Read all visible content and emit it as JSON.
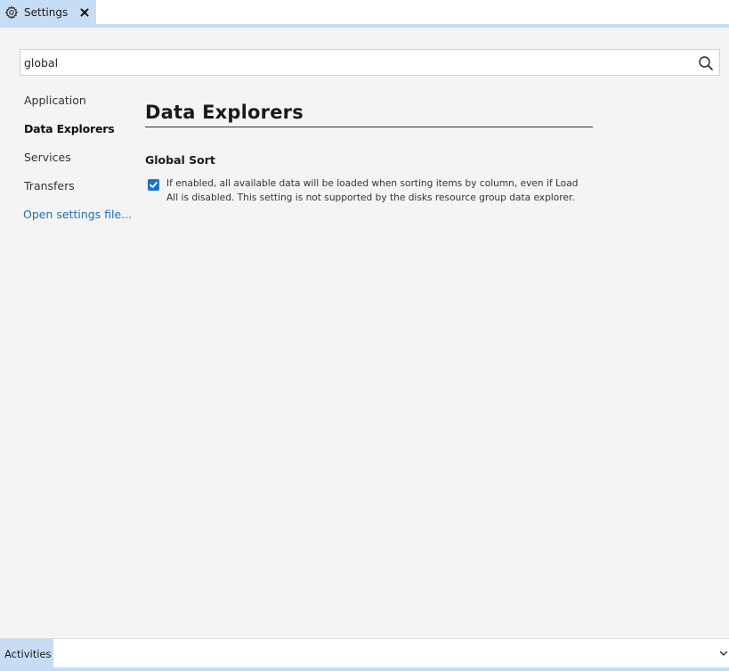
{
  "tab": {
    "icon": "gear-icon",
    "label": "Settings",
    "close_icon": "close-icon"
  },
  "search": {
    "value": "global",
    "icon": "search-icon"
  },
  "nav": {
    "items": [
      {
        "label": "Application",
        "active": false
      },
      {
        "label": "Data Explorers",
        "active": true
      },
      {
        "label": "Services",
        "active": false
      },
      {
        "label": "Transfers",
        "active": false
      }
    ],
    "link_label": "Open settings file..."
  },
  "content": {
    "section_title": "Data Explorers",
    "setting": {
      "title": "Global Sort",
      "checked": true,
      "description": "If enabled, all available data will be loaded when sorting items by column, even if Load All is disabled. This setting is not supported by the disks resource group data explorer."
    }
  },
  "bottom_panel": {
    "tab_label": "Activities",
    "chevron_icon": "chevron-down-icon"
  },
  "colors": {
    "accent_tab": "#c7dcf5",
    "link": "#1f6fb3",
    "checkbox": "#1a73c8"
  }
}
